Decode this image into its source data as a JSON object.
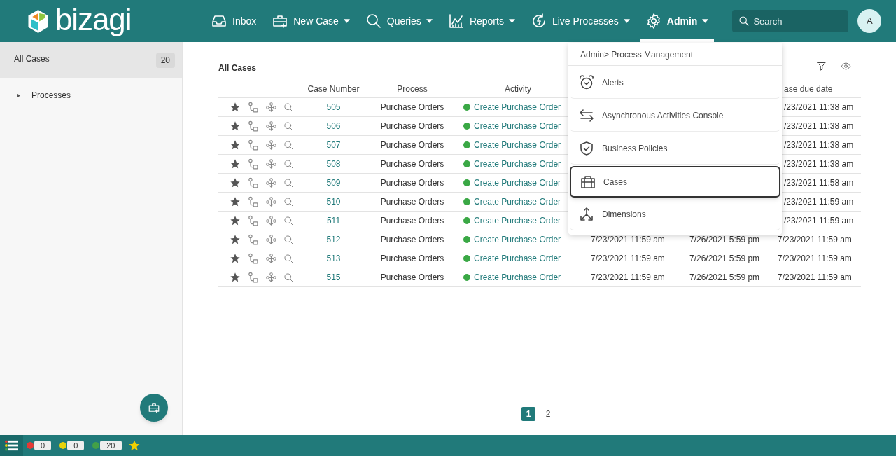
{
  "logo": {
    "text": "bizagi"
  },
  "nav": [
    {
      "label": "Inbox",
      "dropdown": false,
      "selected": false
    },
    {
      "label": "New Case",
      "dropdown": true,
      "selected": false
    },
    {
      "label": "Queries",
      "dropdown": true,
      "selected": false
    },
    {
      "label": "Reports",
      "dropdown": true,
      "selected": false
    },
    {
      "label": "Live Processes",
      "dropdown": true,
      "selected": false
    },
    {
      "label": "Admin",
      "dropdown": true,
      "selected": true
    }
  ],
  "search": {
    "placeholder": "Search"
  },
  "avatar": {
    "initial": "A"
  },
  "sidebar": {
    "items": [
      {
        "label": "All Cases",
        "count": "20",
        "selected": true
      },
      {
        "label": "Processes",
        "expanded": false,
        "selected": false
      }
    ]
  },
  "table": {
    "title": "All Cases",
    "columns": [
      "Case Number",
      "Process",
      "Activity"
    ],
    "due_column": "ase due date",
    "rows": [
      {
        "starred": true,
        "case_number": "505",
        "process": "Purchase Orders",
        "activity": "Create Purchase Order",
        "due": "/23/2021 11:38 am"
      },
      {
        "starred": true,
        "case_number": "506",
        "process": "Purchase Orders",
        "activity": "Create Purchase Order",
        "due": "/23/2021 11:38 am"
      },
      {
        "starred": true,
        "case_number": "507",
        "process": "Purchase Orders",
        "activity": "Create Purchase Order",
        "due": "/23/2021 11:38 am"
      },
      {
        "starred": true,
        "case_number": "508",
        "process": "Purchase Orders",
        "activity": "Create Purchase Order",
        "due": "/23/2021 11:38 am"
      },
      {
        "starred": true,
        "case_number": "509",
        "process": "Purchase Orders",
        "activity": "Create Purchase Order",
        "due": "/23/2021 11:58 am"
      },
      {
        "starred": true,
        "case_number": "510",
        "process": "Purchase Orders",
        "activity": "Create Purchase Order",
        "due": "/23/2021 11:59 am"
      },
      {
        "starred": true,
        "case_number": "511",
        "process": "Purchase Orders",
        "activity": "Create Purchase Order",
        "due": "/23/2021 11:59 am"
      },
      {
        "starred": true,
        "case_number": "512",
        "process": "Purchase Orders",
        "activity": "Create Purchase Order",
        "created": "7/23/2021 11:59 am",
        "solution": "7/26/2021 5:59 pm",
        "due": "7/23/2021 11:59 am"
      },
      {
        "starred": true,
        "case_number": "513",
        "process": "Purchase Orders",
        "activity": "Create Purchase Order",
        "created": "7/23/2021 11:59 am",
        "solution": "7/26/2021 5:59 pm",
        "due": "7/23/2021 11:59 am"
      },
      {
        "starred": true,
        "case_number": "515",
        "process": "Purchase Orders",
        "activity": "Create Purchase Order",
        "created": "7/23/2021 11:59 am",
        "solution": "7/26/2021 5:59 pm",
        "due": "7/23/2021 11:59 am"
      }
    ]
  },
  "pagination": [
    {
      "label": "1",
      "selected": true
    },
    {
      "label": "2",
      "selected": false
    }
  ],
  "admin_menu": {
    "title": "Admin> Process Management",
    "items": [
      {
        "label": "Alerts",
        "selected": false
      },
      {
        "label": "Asynchronous Activities Console",
        "selected": false
      },
      {
        "label": "Business Policies",
        "selected": false
      },
      {
        "label": "Cases",
        "selected": true
      },
      {
        "label": "Dimensions",
        "selected": false
      }
    ]
  },
  "status_bar": {
    "counters": [
      {
        "color": "#e53935",
        "count": "0"
      },
      {
        "color": "#e8d20a",
        "count": "0"
      },
      {
        "color": "#43a047",
        "count": "20"
      }
    ]
  }
}
